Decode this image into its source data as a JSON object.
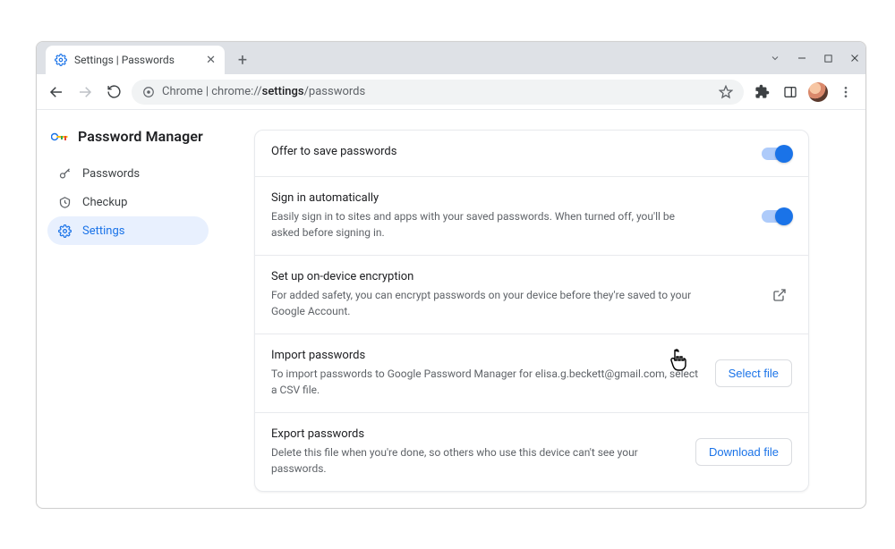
{
  "tab": {
    "title": "Settings | Passwords"
  },
  "omnibox": {
    "origin": "Chrome",
    "url_prefix": "chrome://",
    "url_bold": "settings",
    "url_suffix": "/passwords"
  },
  "page_title": "Password Manager",
  "sidebar": {
    "items": [
      {
        "label": "Passwords"
      },
      {
        "label": "Checkup"
      },
      {
        "label": "Settings"
      }
    ]
  },
  "settings": {
    "offer_save": {
      "title": "Offer to save passwords"
    },
    "auto_signin": {
      "title": "Sign in automatically",
      "desc": "Easily sign in to sites and apps with your saved passwords. When turned off, you'll be asked before signing in."
    },
    "encryption": {
      "title": "Set up on-device encryption",
      "desc": "For added safety, you can encrypt passwords on your device before they're saved to your Google Account."
    },
    "import": {
      "title": "Import passwords",
      "desc": "To import passwords to Google Password Manager for elisa.g.beckett@gmail.com, select a CSV file.",
      "button": "Select file"
    },
    "export": {
      "title": "Export passwords",
      "desc": "Delete this file when you're done, so others who use this device can't see your passwords.",
      "button": "Download file"
    }
  }
}
